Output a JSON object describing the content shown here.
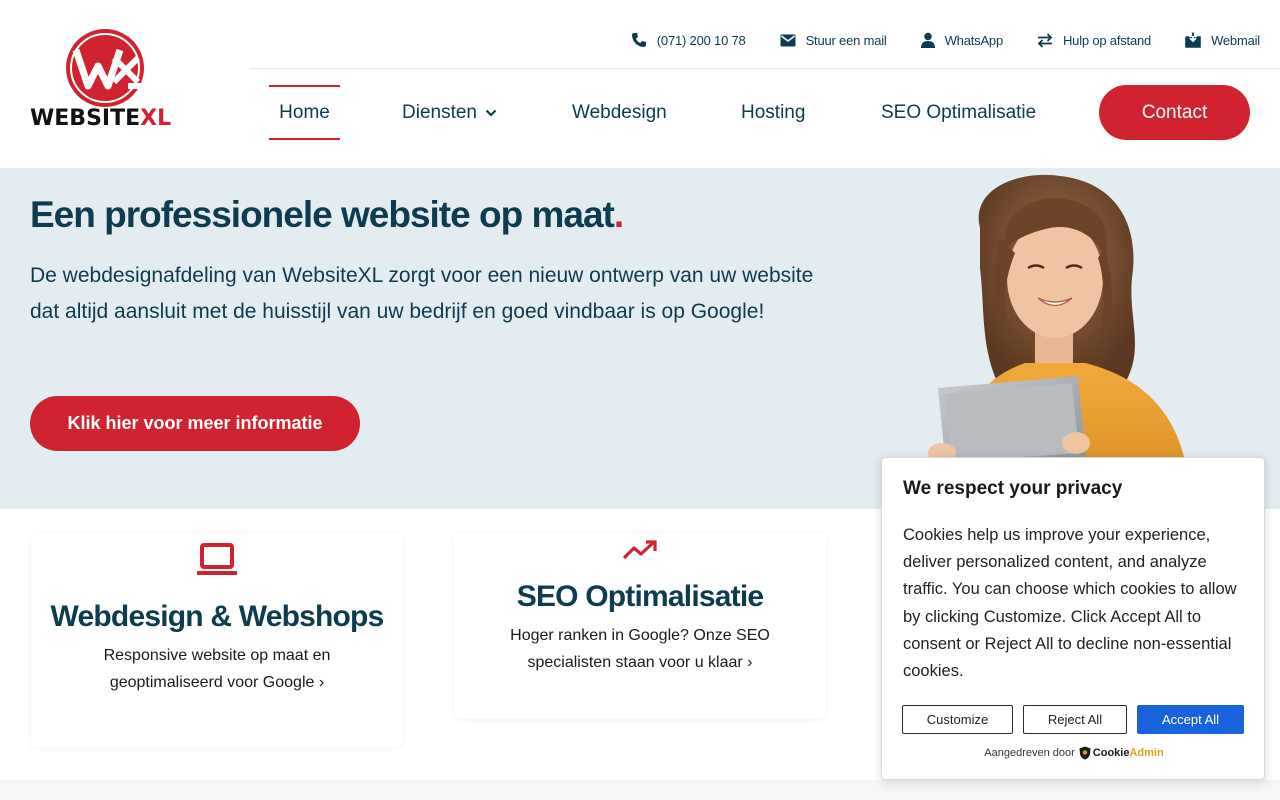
{
  "brand": {
    "name_main": "WEBSITE",
    "name_accent": "XL",
    "logo_letters": "WXL",
    "accent_color": "#d1232f",
    "navy_color": "#0d3b4f"
  },
  "topbar": {
    "phone": "(071) 200 10 78",
    "mail": "Stuur een mail",
    "whatsapp": "WhatsApp",
    "remote_help": "Hulp op afstand",
    "webmail": "Webmail"
  },
  "nav": {
    "items": [
      {
        "label": "Home",
        "active": true
      },
      {
        "label": "Diensten",
        "has_dropdown": true
      },
      {
        "label": "Webdesign"
      },
      {
        "label": "Hosting"
      },
      {
        "label": "SEO Optimalisatie"
      }
    ],
    "contact": "Contact"
  },
  "hero": {
    "title": "Een professionele website op maat",
    "title_dot": ".",
    "text": "De webdesignafdeling van WebsiteXL zorgt voor een nieuw ontwerp van uw website dat altijd aansluit met de huisstijl van uw bedrijf en goed vindbaar is op Google!",
    "button": "Klik hier voor meer informatie"
  },
  "cards": [
    {
      "icon": "laptop-icon",
      "title": "Webdesign & Webshops",
      "text": "Responsive website op maat en geoptimaliseerd voor Google ›"
    },
    {
      "icon": "trending-up-icon",
      "title": "SEO Optimalisatie",
      "text": "Hoger ranken in Google? Onze SEO specialisten staan voor u klaar ›"
    }
  ],
  "cookie": {
    "title": "We respect your privacy",
    "text": "Cookies help us improve your experience, deliver personalized content, and analyze traffic. You can choose which cookies to allow by clicking Customize. Click Accept All to consent or Reject All to decline non-essential cookies.",
    "customize": "Customize",
    "reject": "Reject All",
    "accept": "Accept All",
    "powered_by": "Aangedreven door",
    "powered_brand_a": "Cookie",
    "powered_brand_b": "Admin"
  }
}
